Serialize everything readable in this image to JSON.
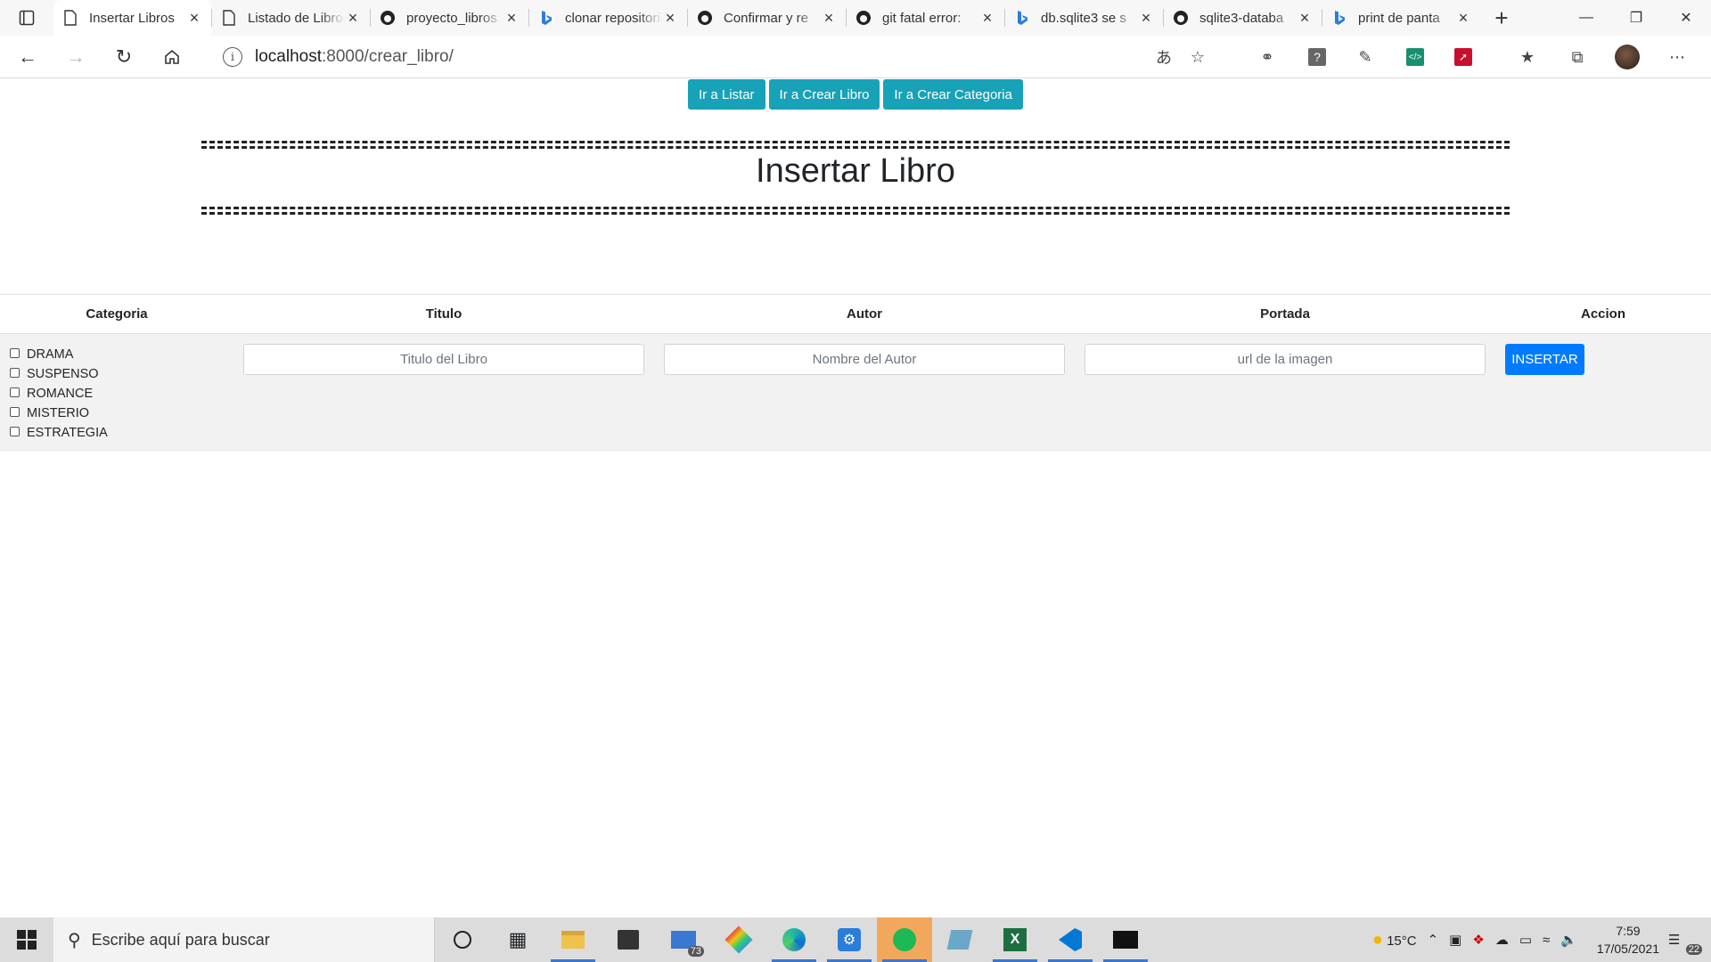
{
  "browser": {
    "tabs": [
      {
        "title": "Insertar Libros",
        "icon": "page-icon",
        "active": true
      },
      {
        "title": "Listado de Libros",
        "icon": "page-icon"
      },
      {
        "title": "proyecto_libros",
        "icon": "github-icon"
      },
      {
        "title": "clonar repositorio",
        "icon": "bing-icon"
      },
      {
        "title": "Confirmar y re",
        "icon": "github-icon"
      },
      {
        "title": "git fatal error:",
        "icon": "github-icon"
      },
      {
        "title": "db.sqlite3 se s",
        "icon": "bing-icon"
      },
      {
        "title": "sqlite3-databa",
        "icon": "github-icon"
      },
      {
        "title": "print de panta",
        "icon": "bing-icon"
      }
    ],
    "url_host": "localhost",
    "url_path": ":8000/crear_libro/"
  },
  "page": {
    "nav_buttons": [
      "Ir a Listar",
      "Ir a Crear Libro",
      "Ir a Crear Categoria"
    ],
    "title": "Insertar Libro",
    "table": {
      "headers": [
        "Categoria",
        "Titulo",
        "Autor",
        "Portada",
        "Accion"
      ],
      "categories": [
        "DRAMA",
        "SUSPENSO",
        "ROMANCE",
        "MISTERIO",
        "ESTRATEGIA"
      ],
      "title_placeholder": "Titulo del Libro",
      "author_placeholder": "Nombre del Autor",
      "cover_placeholder": "url de la imagen",
      "submit_label": "INSERTAR"
    }
  },
  "colors": {
    "nav_button": "#17a2b8",
    "submit_button": "#007bff",
    "form_row_bg": "#f2f2f2"
  },
  "taskbar": {
    "search_placeholder": "Escribe aquí para buscar",
    "mail_badge": "73",
    "weather": "15°C",
    "time": "7:59",
    "date": "17/05/2021",
    "notification_count": "22"
  }
}
